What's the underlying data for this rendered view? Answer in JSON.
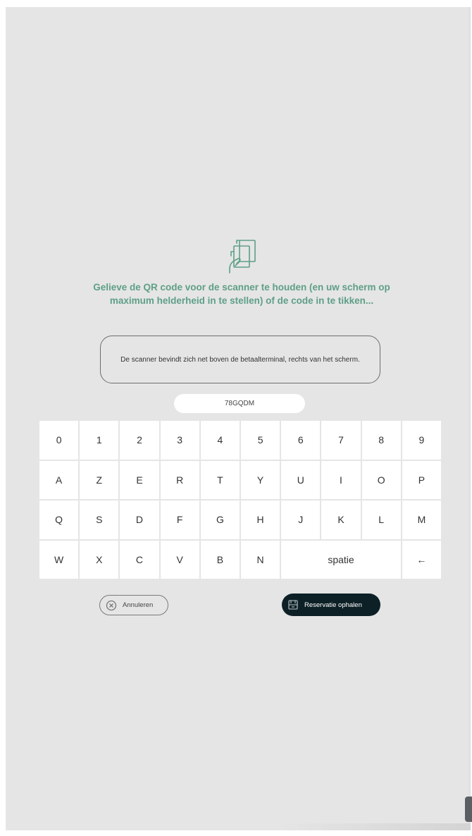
{
  "instruction": {
    "text": "Gelieve de QR code voor de scanner te houden (en uw scherm op maximum helderheid in te stellen) of de code in te tikken..."
  },
  "info": {
    "text": "De scanner bevindt zich net boven de betaalterminal, rechts van het scherm."
  },
  "code_input": {
    "value": "78GQDM"
  },
  "keyboard": {
    "row1": [
      "0",
      "1",
      "2",
      "3",
      "4",
      "5",
      "6",
      "7",
      "8",
      "9"
    ],
    "row2": [
      "A",
      "Z",
      "E",
      "R",
      "T",
      "Y",
      "U",
      "I",
      "O",
      "P"
    ],
    "row3": [
      "Q",
      "S",
      "D",
      "F",
      "G",
      "H",
      "J",
      "K",
      "L",
      "M"
    ],
    "row4": [
      "W",
      "X",
      "C",
      "V",
      "B",
      "N"
    ],
    "space_label": "spatie",
    "backspace_label": "←"
  },
  "actions": {
    "cancel_label": "Annuleren",
    "fetch_label": "Reservatie ophalen"
  },
  "icons": {
    "scan": "qr-scan-icon",
    "cancel": "cancel-circle-icon",
    "fetch": "reservation-icon"
  },
  "colors": {
    "background": "#e5e5e5",
    "accent_green": "#5e9f86",
    "key_background": "#ffffff",
    "primary_button": "#0c2026"
  }
}
